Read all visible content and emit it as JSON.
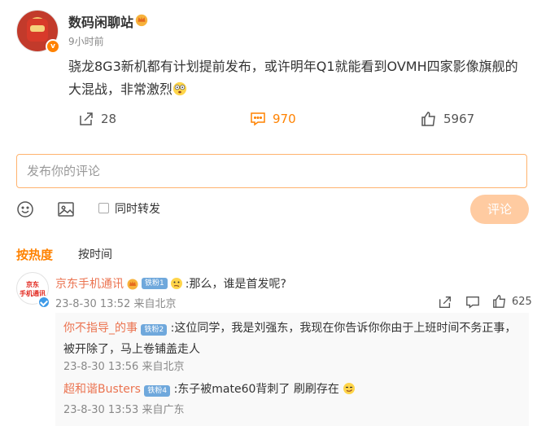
{
  "post": {
    "author": "数码闲聊站",
    "time": "9小时前",
    "text": "骁龙8G3新机都有计划提前发布，或许明年Q1就能看到OVMH四家影像旗舰的大混战，非常激烈",
    "verified_badge": "v"
  },
  "actions": {
    "share_count": "28",
    "comment_count": "970",
    "like_count": "5967"
  },
  "composer": {
    "placeholder": "发布你的评论",
    "repost_label": "同时转发",
    "submit_label": "评论"
  },
  "sort": {
    "hot": "按热度",
    "time": "按时间"
  },
  "comment": {
    "author": "京东手机通讯",
    "fan_badge": "铁粉1",
    "text": ":那么，谁是首发呢?",
    "meta": "23-8-30 13:52 来自北京",
    "like_count": "625",
    "avatar_lines": [
      "京东",
      "手机通讯"
    ]
  },
  "replies": [
    {
      "author": "你不指导_的事",
      "fan_badge": "铁粉2",
      "text": ":这位同学，我是刘强东，我现在你告诉你你由于上班时间不务正事，被开除了，马上卷铺盖走人",
      "meta": "23-8-30 13:56 来自北京"
    },
    {
      "author": "超和谐Busters",
      "fan_badge": "铁粉4",
      "text": ":东子被mate60背刺了 刷刷存在",
      "meta": "23-8-30 13:53 来自广东"
    }
  ],
  "colors": {
    "accent": "#ff8200",
    "username": "#eb7350",
    "submit_disabled": "#ffcba1",
    "input_border": "#ffb36e"
  }
}
